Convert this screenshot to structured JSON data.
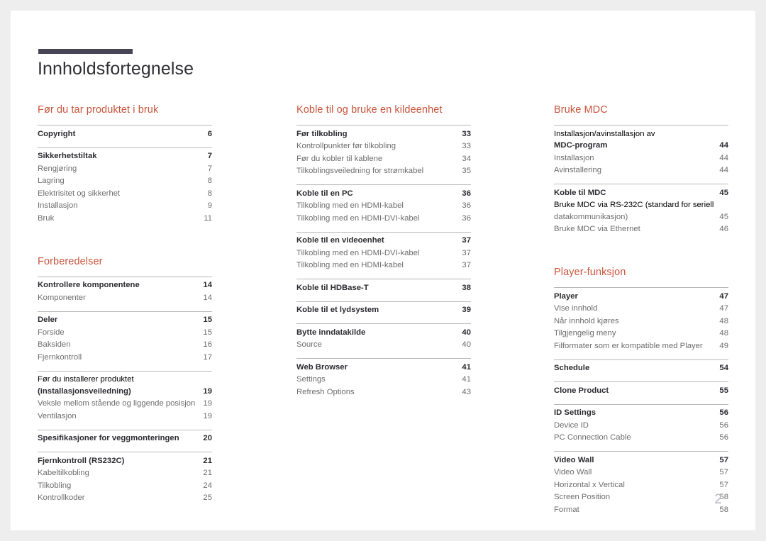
{
  "document": {
    "title": "Innholdsfortegnelse",
    "page_number": "2",
    "accent_color": "#c8553c",
    "rule_color": "#474555"
  },
  "columns": [
    {
      "sections": [
        {
          "heading": "Før du tar produktet i bruk",
          "groups": [
            {
              "entries": [
                {
                  "label": "Copyright",
                  "page": "6",
                  "level": "main"
                }
              ]
            },
            {
              "entries": [
                {
                  "label": "Sikkerhetstiltak",
                  "page": "7",
                  "level": "main"
                },
                {
                  "label": "Rengjøring",
                  "page": "7",
                  "level": "sub"
                },
                {
                  "label": "Lagring",
                  "page": "8",
                  "level": "sub"
                },
                {
                  "label": "Elektrisitet og sikkerhet",
                  "page": "8",
                  "level": "sub"
                },
                {
                  "label": "Installasjon",
                  "page": "9",
                  "level": "sub"
                },
                {
                  "label": "Bruk",
                  "page": "11",
                  "level": "sub"
                }
              ]
            }
          ]
        },
        {
          "heading": "Forberedelser",
          "groups": [
            {
              "entries": [
                {
                  "label": "Kontrollere komponentene",
                  "page": "14",
                  "level": "main"
                },
                {
                  "label": "Komponenter",
                  "page": "14",
                  "level": "sub"
                }
              ]
            },
            {
              "entries": [
                {
                  "label": "Deler",
                  "page": "15",
                  "level": "main"
                },
                {
                  "label": "Forside",
                  "page": "15",
                  "level": "sub"
                },
                {
                  "label": "Baksiden",
                  "page": "16",
                  "level": "sub"
                },
                {
                  "label": "Fjernkontroll",
                  "page": "17",
                  "level": "sub"
                }
              ]
            },
            {
              "entries": [
                {
                  "label": "Før du installerer produktet (installasjonsveiledning)",
                  "line1": "Før du installerer produktet",
                  "line2": "(installasjonsveiledning)",
                  "page": "19",
                  "level": "main",
                  "wrap": true
                },
                {
                  "label": "Veksle mellom stående og liggende posisjon",
                  "page": "19",
                  "level": "sub"
                },
                {
                  "label": "Ventilasjon",
                  "page": "19",
                  "level": "sub"
                }
              ]
            },
            {
              "entries": [
                {
                  "label": "Spesifikasjoner for veggmonteringen",
                  "page": "20",
                  "level": "main"
                }
              ]
            },
            {
              "entries": [
                {
                  "label": "Fjernkontroll (RS232C)",
                  "page": "21",
                  "level": "main"
                },
                {
                  "label": "Kabeltilkobling",
                  "page": "21",
                  "level": "sub"
                },
                {
                  "label": "Tilkobling",
                  "page": "24",
                  "level": "sub"
                },
                {
                  "label": "Kontrollkoder",
                  "page": "25",
                  "level": "sub"
                }
              ]
            }
          ]
        }
      ]
    },
    {
      "sections": [
        {
          "heading": "Koble til og bruke en kildeenhet",
          "groups": [
            {
              "entries": [
                {
                  "label": "Før tilkobling",
                  "page": "33",
                  "level": "main"
                },
                {
                  "label": "Kontrollpunkter før tilkobling",
                  "page": "33",
                  "level": "sub"
                },
                {
                  "label": "Før du kobler til kablene",
                  "page": "34",
                  "level": "sub"
                },
                {
                  "label": "Tilkoblingsveiledning for strømkabel",
                  "page": "35",
                  "level": "sub"
                }
              ]
            },
            {
              "entries": [
                {
                  "label": "Koble til en PC",
                  "page": "36",
                  "level": "main"
                },
                {
                  "label": "Tilkobling med en HDMI-kabel",
                  "page": "36",
                  "level": "sub"
                },
                {
                  "label": "Tilkobling med en HDMI-DVI-kabel",
                  "page": "36",
                  "level": "sub"
                }
              ]
            },
            {
              "entries": [
                {
                  "label": "Koble til en videoenhet",
                  "page": "37",
                  "level": "main"
                },
                {
                  "label": "Tilkobling med en HDMI-DVI-kabel",
                  "page": "37",
                  "level": "sub"
                },
                {
                  "label": "Tilkobling med en HDMI-kabel",
                  "page": "37",
                  "level": "sub"
                }
              ]
            },
            {
              "entries": [
                {
                  "label": "Koble til HDBase-T",
                  "page": "38",
                  "level": "main"
                }
              ]
            },
            {
              "entries": [
                {
                  "label": "Koble til et lydsystem",
                  "page": "39",
                  "level": "main"
                }
              ]
            },
            {
              "entries": [
                {
                  "label": "Bytte inndatakilde",
                  "page": "40",
                  "level": "main"
                },
                {
                  "label": "Source",
                  "page": "40",
                  "level": "sub"
                }
              ]
            },
            {
              "entries": [
                {
                  "label": "Web Browser",
                  "page": "41",
                  "level": "main"
                },
                {
                  "label": "Settings",
                  "page": "41",
                  "level": "sub"
                },
                {
                  "label": "Refresh Options",
                  "page": "43",
                  "level": "sub"
                }
              ]
            }
          ]
        }
      ]
    },
    {
      "sections": [
        {
          "heading": "Bruke MDC",
          "groups": [
            {
              "entries": [
                {
                  "label": "Installasjon/avinstallasjon av MDC-program",
                  "line1": "Installasjon/avinstallasjon av",
                  "line2": "MDC-program",
                  "page": "44",
                  "level": "main",
                  "wrap": true
                },
                {
                  "label": "Installasjon",
                  "page": "44",
                  "level": "sub"
                },
                {
                  "label": "Avinstallering",
                  "page": "44",
                  "level": "sub"
                }
              ]
            },
            {
              "entries": [
                {
                  "label": "Koble til MDC",
                  "page": "45",
                  "level": "main"
                },
                {
                  "label": "Bruke MDC via RS-232C (standard for seriell datakommunikasjon)",
                  "line1": "Bruke MDC via RS-232C (standard for seriell",
                  "line2": "datakommunikasjon)",
                  "page": "45",
                  "level": "sub",
                  "wrap": true
                },
                {
                  "label": "Bruke MDC via Ethernet",
                  "page": "46",
                  "level": "sub"
                }
              ]
            }
          ]
        },
        {
          "heading": "Player-funksjon",
          "groups": [
            {
              "entries": [
                {
                  "label": "Player",
                  "page": "47",
                  "level": "main"
                },
                {
                  "label": "Vise innhold",
                  "page": "47",
                  "level": "sub"
                },
                {
                  "label": "Når innhold kjøres",
                  "page": "48",
                  "level": "sub"
                },
                {
                  "label": "Tilgjengelig meny",
                  "page": "48",
                  "level": "sub"
                },
                {
                  "label": "Filformater som er kompatible med Player",
                  "page": "49",
                  "level": "sub"
                }
              ]
            },
            {
              "entries": [
                {
                  "label": "Schedule",
                  "page": "54",
                  "level": "main"
                }
              ]
            },
            {
              "entries": [
                {
                  "label": "Clone Product",
                  "page": "55",
                  "level": "main"
                }
              ]
            },
            {
              "entries": [
                {
                  "label": "ID Settings",
                  "page": "56",
                  "level": "main"
                },
                {
                  "label": "Device ID",
                  "page": "56",
                  "level": "sub"
                },
                {
                  "label": "PC Connection Cable",
                  "page": "56",
                  "level": "sub"
                }
              ]
            },
            {
              "entries": [
                {
                  "label": "Video Wall",
                  "page": "57",
                  "level": "main"
                },
                {
                  "label": "Video Wall",
                  "page": "57",
                  "level": "sub"
                },
                {
                  "label": "Horizontal x Vertical",
                  "page": "57",
                  "level": "sub"
                },
                {
                  "label": "Screen Position",
                  "page": "58",
                  "level": "sub"
                },
                {
                  "label": "Format",
                  "page": "58",
                  "level": "sub"
                }
              ]
            }
          ]
        }
      ]
    }
  ]
}
